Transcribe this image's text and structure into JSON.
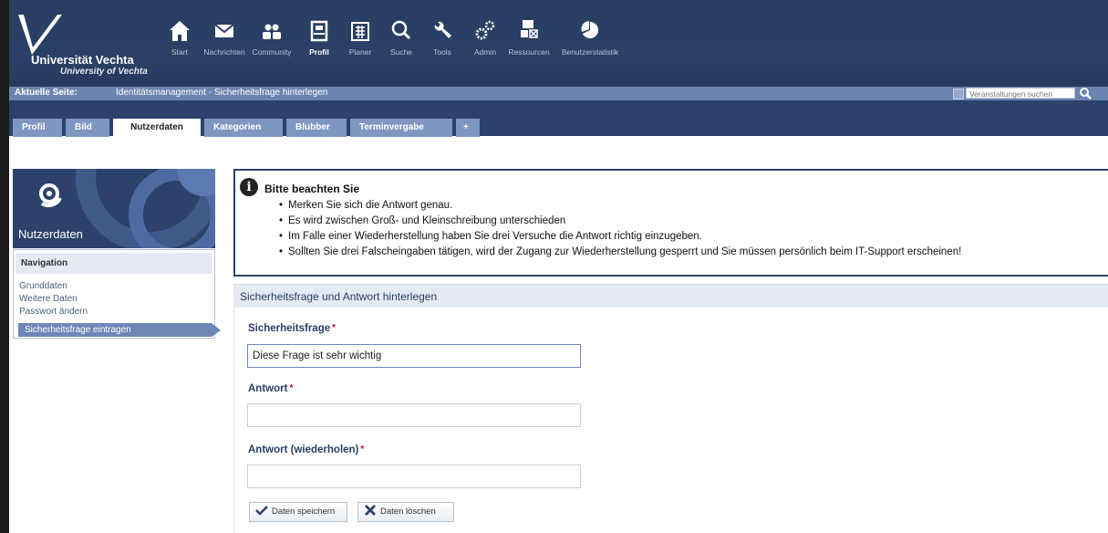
{
  "header": {
    "uni_name": "Universität Vechta",
    "uni_sub": "University of Vechta",
    "nav": [
      {
        "label": "Start",
        "icon": "home-icon"
      },
      {
        "label": "Nachrichten",
        "icon": "mail-icon"
      },
      {
        "label": "Community",
        "icon": "community-icon"
      },
      {
        "label": "Profil",
        "icon": "profile-icon",
        "active": true
      },
      {
        "label": "Planer",
        "icon": "planner-icon"
      },
      {
        "label": "Suche",
        "icon": "search-icon"
      },
      {
        "label": "Tools",
        "icon": "wrench-icon"
      },
      {
        "label": "Admin",
        "icon": "gears-icon"
      },
      {
        "label": "Ressourcen",
        "icon": "resources-icon"
      },
      {
        "label": "Benutzerstatistik",
        "icon": "statistics-icon"
      }
    ]
  },
  "breadcrumb": {
    "label": "Aktuelle Seite:",
    "value": "Identitätsmanagement - Sicherheitsfrage hinterlegen",
    "search_placeholder": "Veranstaltungen suchen"
  },
  "tabs": [
    "Profil",
    "Bild",
    "Nutzerdaten",
    "Kategorien",
    "Blubber",
    "Terminvergabe",
    "+"
  ],
  "active_tab": "Nutzerdaten",
  "sidebar": {
    "title": "Nutzerdaten",
    "nav_title": "Navigation",
    "items": [
      "Grunddaten",
      "Weitere Daten",
      "Passwort ändern",
      "Sicherheitsfrage eintragen"
    ]
  },
  "info": {
    "title": "Bitte beachten Sie",
    "items": [
      "Merken Sie sich die Antwort genau.",
      "Es wird zwischen Groß- und Kleinschreibung unterschieden",
      "Im Falle einer Wiederherstellung haben Sie drei Versuche die Antwort richtig einzugeben.",
      "Sollten Sie drei Falscheingaben tätigen, wird der Zugang zur Wiederherstellung gesperrt und Sie müssen persönlich beim IT-Support erscheinen!"
    ]
  },
  "form": {
    "title": "Sicherheitsfrage und Antwort hinterlegen",
    "question_label": "Sicherheitsfrage",
    "question_value": "Diese Frage ist sehr wichtig",
    "answer_label": "Antwort",
    "answer_value": "",
    "answer_repeat_label": "Antwort (wiederholen)",
    "answer_repeat_value": "",
    "required_mark": "*",
    "save_label": "Daten speichern",
    "delete_label": "Daten löschen"
  },
  "colors": {
    "header": "#2a4066",
    "tab": "#7e96c0",
    "accent": "#6f87b6",
    "required": "#d0021b"
  }
}
